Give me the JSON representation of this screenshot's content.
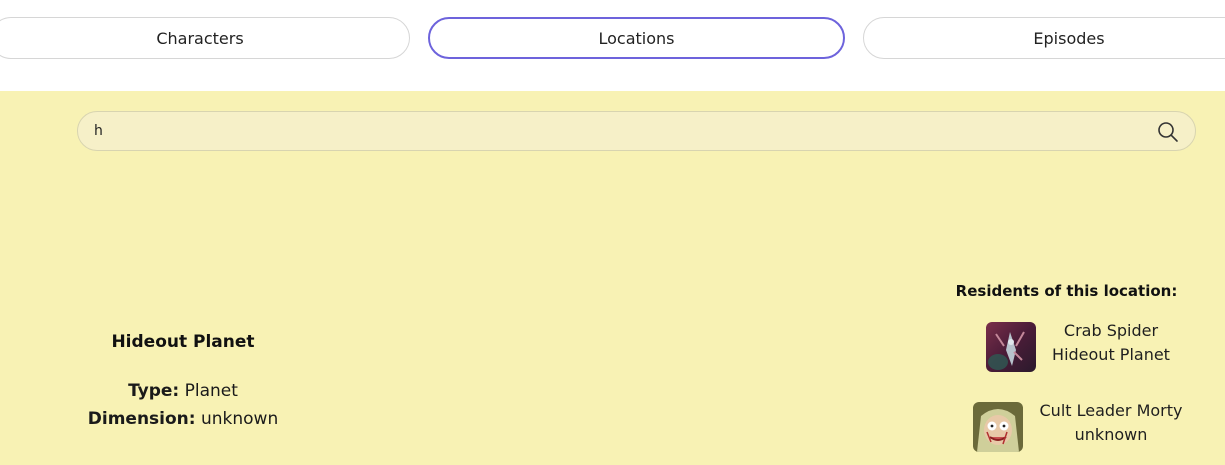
{
  "tabs": [
    {
      "label": "Characters",
      "active": false
    },
    {
      "label": "Locations",
      "active": true
    },
    {
      "label": "Episodes",
      "active": false
    }
  ],
  "search": {
    "value": "h",
    "icon": "search-icon"
  },
  "location": {
    "name": "Hideout Planet",
    "type_label": "Type:",
    "type_value": "Planet",
    "dimension_label": "Dimension:",
    "dimension_value": "unknown"
  },
  "residents": {
    "title": "Residents of this location:",
    "items": [
      {
        "name": "Crab Spider",
        "detail": "Hideout Planet"
      },
      {
        "name": "Cult Leader Morty",
        "detail": "unknown"
      }
    ]
  },
  "colors": {
    "background": "#f8f2b4",
    "active_tab_border": "#6d63dc",
    "search_bg": "#f6f0c8"
  }
}
